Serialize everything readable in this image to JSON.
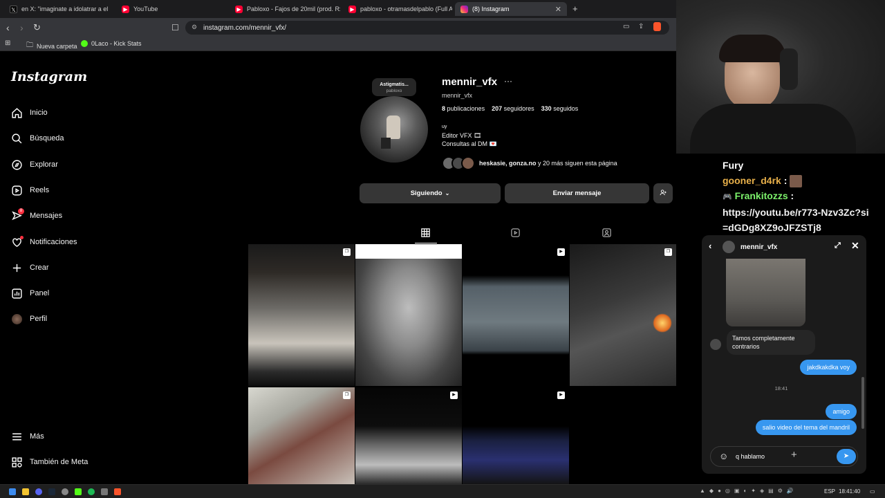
{
  "browser": {
    "tabs": [
      {
        "title": "en X: \"imaginate a idolatrar a el",
        "icon": "x-icon"
      },
      {
        "title": "YouTube",
        "icon": "youtube-icon"
      },
      {
        "title": "Pabloxo - Fajos de 20mil (prod. Rxcan",
        "icon": "youtube-icon"
      },
      {
        "title": "pabloxo - otramasdelpablo (Full Albu",
        "icon": "youtube-icon"
      },
      {
        "title": "(8) Instagram",
        "icon": "instagram-icon",
        "active": true
      }
    ],
    "new_tab": "+",
    "url": "instagram.com/mennir_vfx/",
    "bookmarks": [
      {
        "label": "Nueva carpeta",
        "icon": "folder-icon"
      },
      {
        "label": "0Laco - Kick Stats",
        "icon": "kick-icon"
      }
    ]
  },
  "sidebar": {
    "logo": "Instagram",
    "items": [
      {
        "label": "Inicio",
        "icon": "home-icon"
      },
      {
        "label": "Búsqueda",
        "icon": "search-icon"
      },
      {
        "label": "Explorar",
        "icon": "compass-icon"
      },
      {
        "label": "Reels",
        "icon": "reels-icon"
      },
      {
        "label": "Mensajes",
        "icon": "messenger-icon",
        "badge": "8"
      },
      {
        "label": "Notificaciones",
        "icon": "heart-icon"
      },
      {
        "label": "Crear",
        "icon": "plus-icon"
      },
      {
        "label": "Panel",
        "icon": "chart-icon"
      },
      {
        "label": "Perfil",
        "icon": "avatar"
      }
    ],
    "more": "Más",
    "meta": "También de Meta"
  },
  "profile": {
    "note_title": "Astigmatis...",
    "note_sub": "pabloxo",
    "username": "mennir_vfx",
    "handle": "mennir_vfx",
    "posts_count": "8",
    "posts_label": "publicaciones",
    "followers_count": "207",
    "followers_label": "seguidores",
    "following_count": "330",
    "following_label": "seguidos",
    "bio_line1": "uy",
    "bio_line2": "Editor VFX 🎞",
    "bio_line3": "Consultas al DM 💌",
    "followed_by_names": "heskasie, gonza.no",
    "followed_by_rest": "y 20 más siguen esta página",
    "btn_following": "Siguiendo",
    "btn_message": "Enviar mensaje"
  },
  "stream_chat": {
    "line1": "Fury",
    "user2": "gooner_d4rk",
    "user3": "Frankitozzs",
    "link": "https://youtu.be/r773-Nzv3Zc?si=dGDg8XZ9oJFZSTj8"
  },
  "dm": {
    "name": "mennir_vfx",
    "msg_in": "Tamos completamente contrarios",
    "msg_out1": "jakdkakdka voy",
    "time": "18:41",
    "msg_out2": "amigo",
    "msg_out3": "salio video del tema del mandril",
    "input_value": "q hablamo"
  },
  "taskbar": {
    "lang": "ESP",
    "time": "18:41:40"
  },
  "colors": {
    "accent": "#3797f0",
    "badge": "#ff3040",
    "chat_gold": "#e8b04a",
    "chat_green": "#7cf16b"
  }
}
